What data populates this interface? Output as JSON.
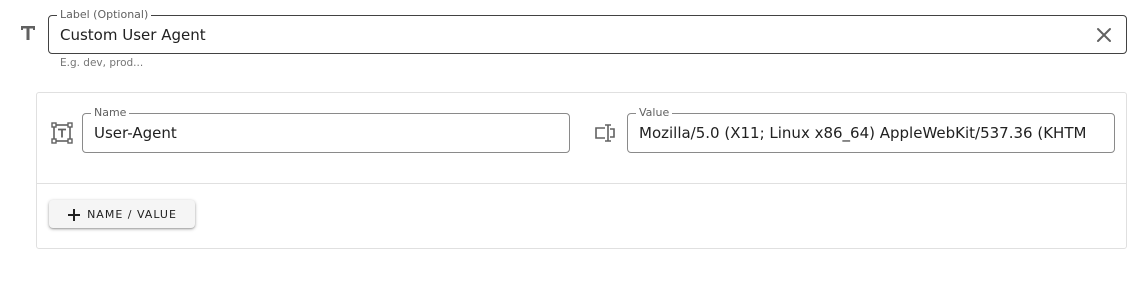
{
  "label_field": {
    "legend": "Label (Optional)",
    "value": "Custom User Agent",
    "helper": "E.g. dev, prod..."
  },
  "header": {
    "name_field": {
      "legend": "Name",
      "value": "User-Agent"
    },
    "value_field": {
      "legend": "Value",
      "value": "Mozilla/5.0 (X11; Linux x86_64) AppleWebKit/537.36 (KHTM"
    }
  },
  "add_button": {
    "label": "NAME / VALUE"
  },
  "icons": {
    "label": "text-format-icon",
    "clear": "close-icon",
    "name": "text-box-outline-icon",
    "value": "form-textbox-icon",
    "add": "plus-icon"
  }
}
